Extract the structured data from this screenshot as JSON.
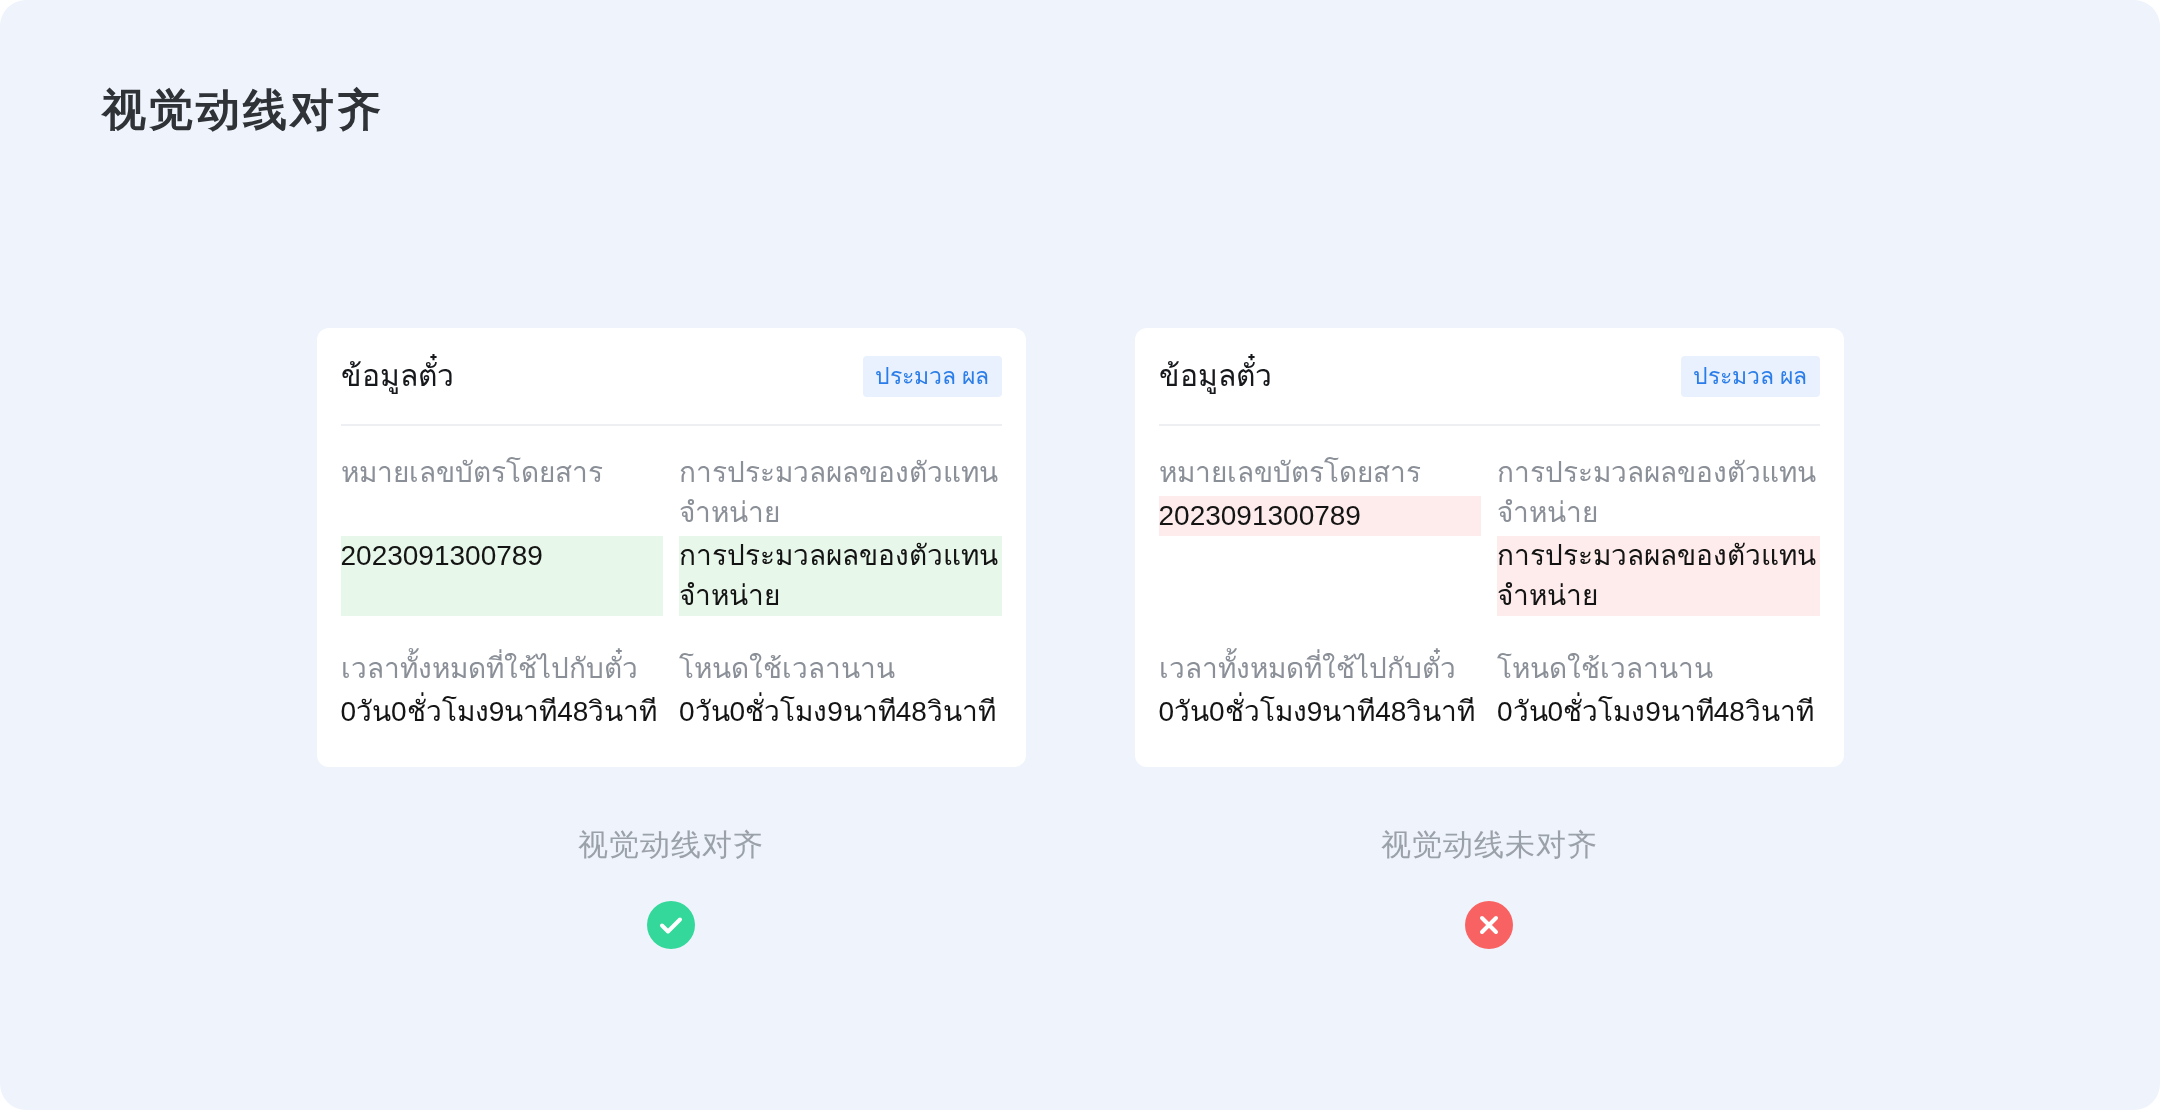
{
  "title": "视觉动线对齐",
  "examples": [
    {
      "aligned": true,
      "card": {
        "title": "ข้อมูลตั๋ว",
        "action_button": "ประมวล ผล",
        "rows": [
          {
            "fields": [
              {
                "label": "หมายเลขบัตรโดยสาร",
                "value": "2023091300789",
                "highlighted": true
              },
              {
                "label": "การประมวลผลของตัวแทนจำหน่าย",
                "value": "การประมวลผลของตัวแทนจำหน่าย",
                "highlighted": true
              }
            ]
          },
          {
            "fields": [
              {
                "label": "เวลาทั้งหมดที่ใช้ไปกับตั๋ว",
                "value": "0วัน0ชั่วโมง9นาที48วินาที",
                "highlighted": false
              },
              {
                "label": "โหนดใช้เวลานาน",
                "value": "0วัน0ชั่วโมง9นาที48วินาที",
                "highlighted": false
              }
            ]
          }
        ]
      },
      "caption": "视觉动线对齐"
    },
    {
      "aligned": false,
      "card": {
        "title": "ข้อมูลตั๋ว",
        "action_button": "ประมวล ผล",
        "rows": [
          {
            "fields": [
              {
                "label": "หมายเลขบัตรโดยสาร",
                "value": "2023091300789",
                "highlighted": true
              },
              {
                "label": "การประมวลผลของตัวแทนจำหน่าย",
                "value": "การประมวลผลของตัวแทนจำหน่าย",
                "highlighted": true
              }
            ]
          },
          {
            "fields": [
              {
                "label": "เวลาทั้งหมดที่ใช้ไปกับตั๋ว",
                "value": "0วัน0ชั่วโมง9นาที48วินาที",
                "highlighted": false
              },
              {
                "label": "โหนดใช้เวลานาน",
                "value": "0วัน0ชั่วโมง9นาที48วินาที",
                "highlighted": false
              }
            ]
          }
        ]
      },
      "caption": "视觉动线未对齐"
    }
  ]
}
